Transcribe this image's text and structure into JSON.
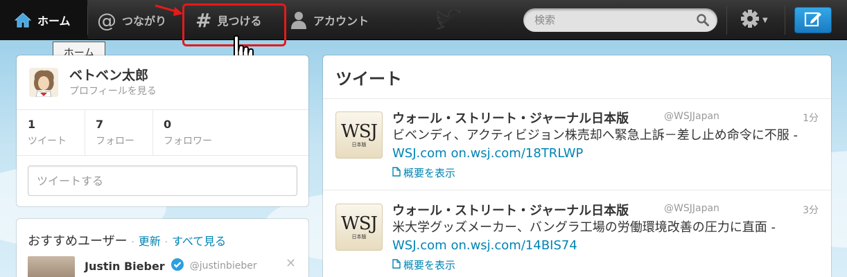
{
  "nav": {
    "home": "ホーム",
    "connect": "つながり",
    "discover": "見つける",
    "account": "アカウント"
  },
  "search": {
    "placeholder": "検索"
  },
  "tooltip": "ホーム",
  "profile": {
    "name": "ベトベン太郎",
    "link": "プロフィールを見る",
    "stats": [
      {
        "num": "1",
        "label": "ツイート"
      },
      {
        "num": "7",
        "label": "フォロー"
      },
      {
        "num": "0",
        "label": "フォロワー"
      }
    ],
    "compose_placeholder": "ツイートする"
  },
  "who_to_follow": {
    "title": "おすすめユーザー",
    "sep": "·",
    "refresh": "更新",
    "view_all": "すべて見る",
    "user": {
      "name": "Justin Bieber",
      "handle": "@justinbieber",
      "close": "✕"
    }
  },
  "timeline": {
    "title": "ツイート",
    "tweets": [
      {
        "name": "ウォール・ストリート・ジャーナル日本版",
        "handle": "@WSJJapan",
        "time": "1分",
        "text": "ビベンディ、アクティビジョン株売却へ緊急上訴－差し止め命令に不服 - ",
        "link1": "WSJ.com",
        "link2": "on.wsj.com/18TRLWP",
        "expand": "概要を表示",
        "logo": "WSJ",
        "logo_sub": "日本版"
      },
      {
        "name": "ウォール・ストリート・ジャーナル日本版",
        "handle": "@WSJJapan",
        "time": "3分",
        "text": "米大学グッズメーカー、バングラ工場の労働環境改善の圧力に直面 - ",
        "link1": "WSJ.com",
        "link2": "on.wsj.com/14BIS74",
        "expand": "概要を表示",
        "logo": "WSJ",
        "logo_sub": "日本版"
      }
    ]
  },
  "colors": {
    "accent": "#0084b4",
    "highlight": "#e51a1a",
    "topbar": "#262626",
    "tweet_button": "#1a7bc0"
  }
}
